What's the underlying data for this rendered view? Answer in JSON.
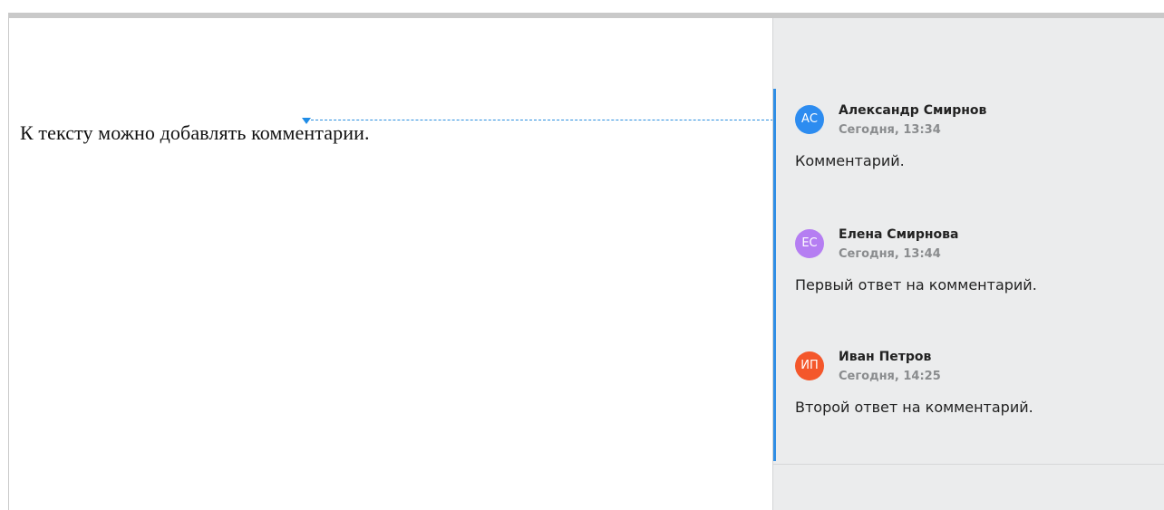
{
  "document": {
    "text": "К тексту можно добавлять комментарии."
  },
  "comments": [
    {
      "initials": "АС",
      "author": "Александр Смирнов",
      "time": "Сегодня, 13:34",
      "text": "Комментарий.",
      "avatar_color": "#2d8cf0"
    },
    {
      "initials": "ЕС",
      "author": "Елена Смирнова",
      "time": "Сегодня, 13:44",
      "text": "Первый ответ на комментарий.",
      "avatar_color": "#b57ef2"
    },
    {
      "initials": "ИП",
      "author": "Иван Петров",
      "time": "Сегодня, 14:25",
      "text": "Второй ответ на комментарий.",
      "avatar_color": "#f4572b"
    }
  ],
  "colors": {
    "accent": "#2f8ee5",
    "panel_background": "#ebeced"
  }
}
